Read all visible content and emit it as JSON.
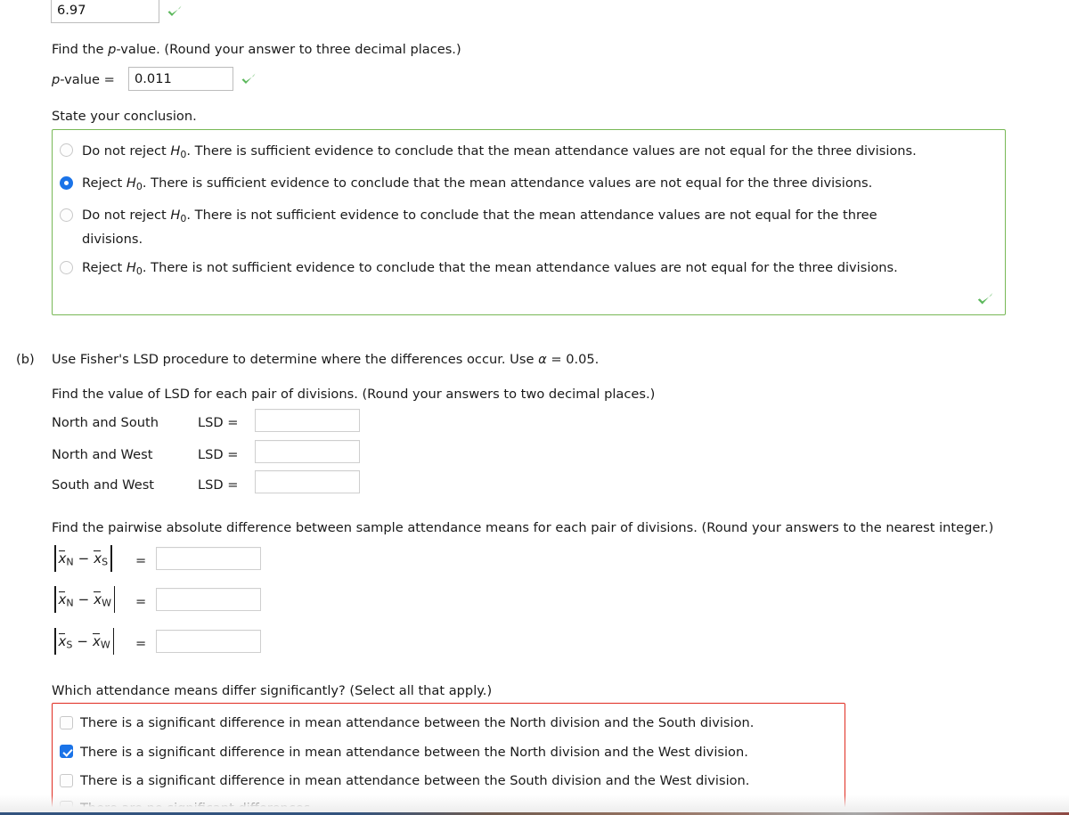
{
  "part_a": {
    "test_statistic_value": "6.97",
    "pvalue_prompt": "Find the p-value. (Round your answer to three decimal places.)",
    "pvalue_prompt_lead": "Find the ",
    "pvalue_prompt_italic": "p",
    "pvalue_prompt_tail": "-value. (Round your answer to three decimal places.)",
    "pvalue_label_italic": "p",
    "pvalue_label_tail": "-value  =",
    "pvalue_value": "0.011",
    "conclusion_prompt": "State your conclusion.",
    "conclusion_options": [
      {
        "lead": "Do not reject ",
        "symbol": "H",
        "subscript": "0",
        "tail": ". There is sufficient evidence to conclude that the mean attendance values are not equal for the three divisions.",
        "selected": false,
        "wrapped_tail": ""
      },
      {
        "lead": "Reject ",
        "symbol": "H",
        "subscript": "0",
        "tail": ". There is sufficient evidence to conclude that the mean attendance values are not equal for the three divisions.",
        "selected": true,
        "wrapped_tail": ""
      },
      {
        "lead": "Do not reject ",
        "symbol": "H",
        "subscript": "0",
        "tail": ". There is not sufficient evidence to conclude that the mean attendance values are not equal for the three",
        "selected": false,
        "wrapped_tail": "divisions."
      },
      {
        "lead": "Reject ",
        "symbol": "H",
        "subscript": "0",
        "tail": ". There is not sufficient evidence to conclude that the mean attendance values are not equal for the three divisions.",
        "selected": false,
        "wrapped_tail": ""
      }
    ]
  },
  "part_b": {
    "marker": "(b)",
    "prompt_lead": "Use Fisher's LSD procedure to determine where the differences occur. Use ",
    "prompt_alpha": "α",
    "prompt_tail": " = 0.05.",
    "lsd_prompt": "Find the value of LSD for each pair of divisions. (Round your answers to two decimal places.)",
    "lsd_rows": [
      {
        "pair": "North and South",
        "label": "LSD  =",
        "value": ""
      },
      {
        "pair": "North and West",
        "label": "LSD  =",
        "value": ""
      },
      {
        "pair": "South and West",
        "label": "LSD  =",
        "value": ""
      }
    ],
    "pairwise_prompt": "Find the pairwise absolute difference between sample attendance means for each pair of divisions. (Round your answers to the nearest integer.)",
    "pairwise_rows": [
      {
        "var": "x",
        "sub1": "N",
        "sub2": "S",
        "eq": "=",
        "value": ""
      },
      {
        "var": "x",
        "sub1": "N",
        "sub2": "W",
        "eq": "=",
        "value": ""
      },
      {
        "var": "x",
        "sub1": "S",
        "sub2": "W",
        "eq": "=",
        "value": ""
      }
    ],
    "significance_prompt": "Which attendance means differ significantly? (Select all that apply.)",
    "significance_options": [
      {
        "label": "There is a significant difference in mean attendance between the North division and the South division.",
        "checked": false
      },
      {
        "label": "There is a significant difference in mean attendance between the North division and the West division.",
        "checked": true
      },
      {
        "label": "There is a significant difference in mean attendance between the South division and the West division.",
        "checked": false
      },
      {
        "label": "There are no significant differences.",
        "checked": false
      }
    ]
  },
  "colors": {
    "correct_green": "#5cb85c",
    "box_green": "#78b856",
    "box_red": "#e02b20",
    "selected_blue": "#1a73e8"
  }
}
